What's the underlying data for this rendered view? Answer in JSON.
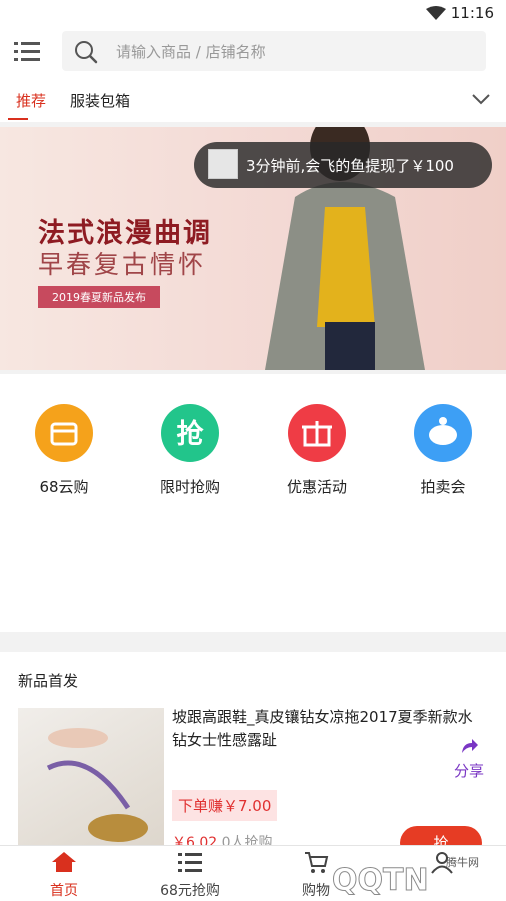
{
  "status_bar": {
    "time": "11:16"
  },
  "search": {
    "placeholder": "请输入商品 / 店铺名称"
  },
  "tabs": [
    {
      "label": "推荐"
    },
    {
      "label": "服装包箱"
    }
  ],
  "banner": {
    "title": "法式浪漫曲调",
    "subtitle": "早春复古情怀",
    "tag": "2019春夏新品发布"
  },
  "toast": {
    "message": "3分钟前,会飞的鱼提现了￥100"
  },
  "quick_entries": [
    {
      "label": "68云购",
      "color": "#f5a21b",
      "icon": "store-icon"
    },
    {
      "label": "限时抢购",
      "color": "#22c58b",
      "icon": "grab-icon"
    },
    {
      "label": "优惠活动",
      "color": "#ef3c45",
      "icon": "gift-icon"
    },
    {
      "label": "拍卖会",
      "color": "#3d9ff5",
      "icon": "piggy-bank-icon"
    }
  ],
  "new_arrivals": {
    "title": "新品首发",
    "product": {
      "name": "坡跟高跟鞋_真皮镶钻女凉拖2017夏季新款水钻女士性感露趾",
      "earn": "下单赚￥7.00",
      "price": "￥6.02",
      "buyers": "0人抢购",
      "share_label": "分享",
      "grab_label": "抢"
    }
  },
  "bottom_nav": [
    {
      "label": "首页",
      "icon": "home-icon"
    },
    {
      "label": "68元抢购",
      "icon": "list-icon"
    },
    {
      "label": "购物",
      "icon": "cart-icon"
    },
    {
      "label": "",
      "icon": "user-icon"
    }
  ],
  "watermark": {
    "text": "QQTN",
    "site": "腾牛网"
  },
  "colors": {
    "accent": "#d9301e",
    "share": "#7a36c4"
  }
}
